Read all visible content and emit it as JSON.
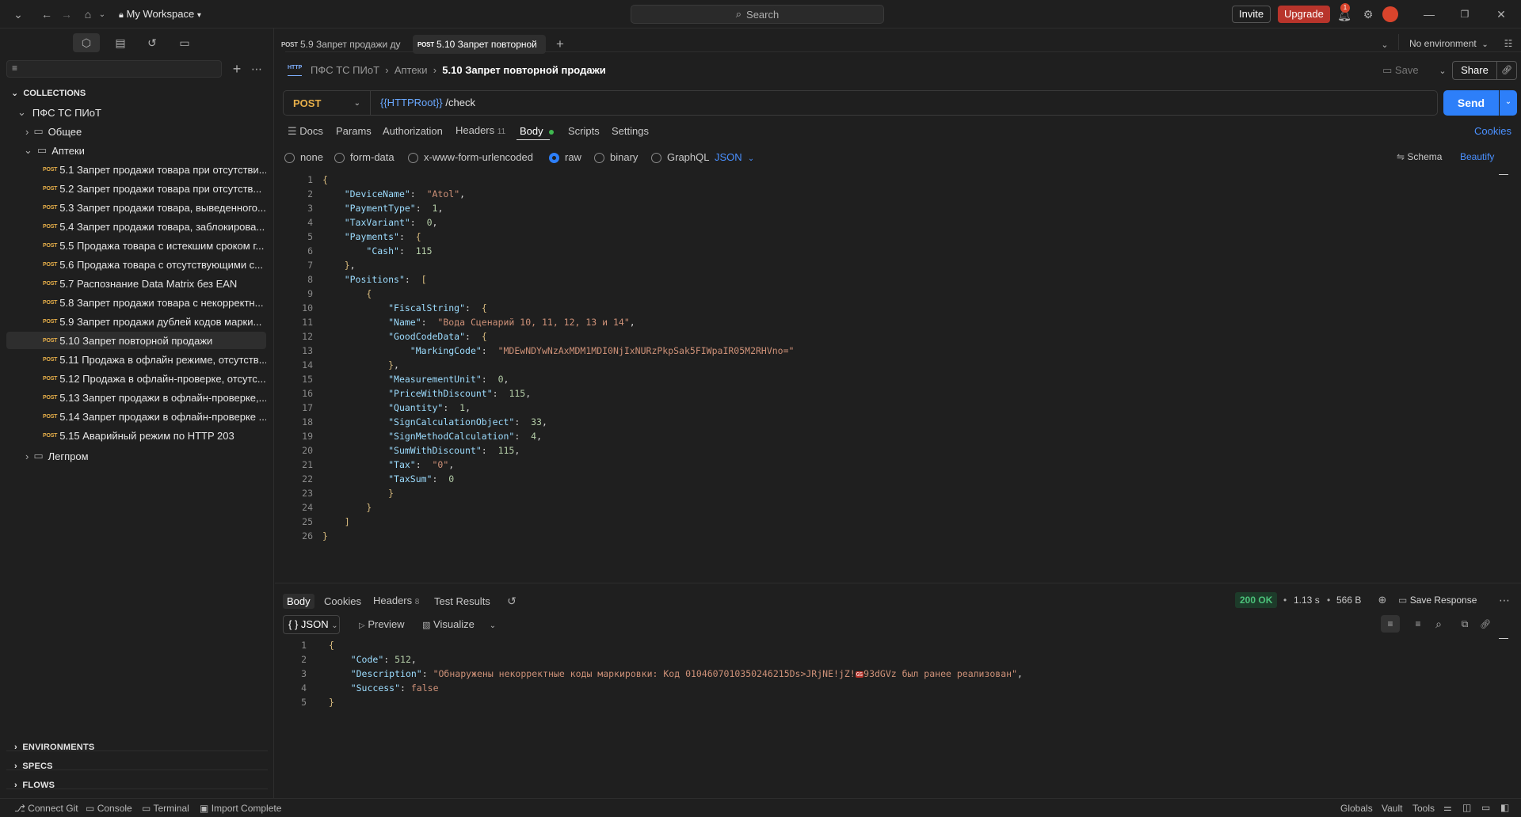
{
  "topbar": {
    "workspace": "My Workspace",
    "search_placeholder": "Search",
    "invite": "Invite",
    "upgrade": "Upgrade",
    "notif_count": "1"
  },
  "tabs": [
    {
      "method": "POST",
      "title": "5.9 Запрет продажи ду"
    },
    {
      "method": "POST",
      "title": "5.10 Запрет повторной"
    }
  ],
  "environment": "No environment",
  "breadcrumb": {
    "collection": "ПФС ТС ПИоТ",
    "folder": "Аптеки",
    "current": "5.10 Запрет повторной продажи"
  },
  "request": {
    "method": "POST",
    "url_var": "{{HTTPRoot}}",
    "url_path": " /check",
    "save": "Save",
    "share": "Share",
    "send": "Send"
  },
  "req_tabs": {
    "docs": "Docs",
    "params": "Params",
    "authorization": "Authorization",
    "headers": "Headers",
    "headers_count": "11",
    "body": "Body",
    "scripts": "Scripts",
    "settings": "Settings",
    "cookies": "Cookies"
  },
  "body_types": {
    "none": "none",
    "form_data": "form-data",
    "urlencoded": "x-www-form-urlencoded",
    "raw": "raw",
    "binary": "binary",
    "graphql": "GraphQL",
    "format": "JSON",
    "schema": "Schema",
    "beautify": "Beautify"
  },
  "request_body": [
    [
      {
        "t": "{",
        "c": "b"
      }
    ],
    [
      {
        "t": "    "
      },
      {
        "t": "\"DeviceName\"",
        "c": "k"
      },
      {
        "t": ":  "
      },
      {
        "t": "\"Atol\"",
        "c": "s"
      },
      {
        "t": ","
      }
    ],
    [
      {
        "t": "    "
      },
      {
        "t": "\"PaymentType\"",
        "c": "k"
      },
      {
        "t": ":  "
      },
      {
        "t": "1",
        "c": "n"
      },
      {
        "t": ","
      }
    ],
    [
      {
        "t": "    "
      },
      {
        "t": "\"TaxVariant\"",
        "c": "k"
      },
      {
        "t": ":  "
      },
      {
        "t": "0",
        "c": "n"
      },
      {
        "t": ","
      }
    ],
    [
      {
        "t": "    "
      },
      {
        "t": "\"Payments\"",
        "c": "k"
      },
      {
        "t": ":  "
      },
      {
        "t": "{",
        "c": "b"
      }
    ],
    [
      {
        "t": "        "
      },
      {
        "t": "\"Cash\"",
        "c": "k"
      },
      {
        "t": ":  "
      },
      {
        "t": "115",
        "c": "n"
      }
    ],
    [
      {
        "t": "    "
      },
      {
        "t": "}",
        "c": "b"
      },
      {
        "t": ","
      }
    ],
    [
      {
        "t": "    "
      },
      {
        "t": "\"Positions\"",
        "c": "k"
      },
      {
        "t": ":  "
      },
      {
        "t": "[",
        "c": "b"
      }
    ],
    [
      {
        "t": "        "
      },
      {
        "t": "{",
        "c": "b"
      }
    ],
    [
      {
        "t": "            "
      },
      {
        "t": "\"FiscalString\"",
        "c": "k"
      },
      {
        "t": ":  "
      },
      {
        "t": "{",
        "c": "b"
      }
    ],
    [
      {
        "t": "            "
      },
      {
        "t": "\"Name\"",
        "c": "k"
      },
      {
        "t": ":  "
      },
      {
        "t": "\"Вода Сценарий 10, 11, 12, 13 и 14\"",
        "c": "s"
      },
      {
        "t": ","
      }
    ],
    [
      {
        "t": "            "
      },
      {
        "t": "\"GoodCodeData\"",
        "c": "k"
      },
      {
        "t": ":  "
      },
      {
        "t": "{",
        "c": "b"
      }
    ],
    [
      {
        "t": "                "
      },
      {
        "t": "\"MarkingCode\"",
        "c": "k"
      },
      {
        "t": ":  "
      },
      {
        "t": "\"MDEwNDYwNzAxMDM1MDI0NjIxNURzPkpSak5FIWpaIR05M2RHVno=\"",
        "c": "s"
      }
    ],
    [
      {
        "t": "            "
      },
      {
        "t": "}",
        "c": "b"
      },
      {
        "t": ","
      }
    ],
    [
      {
        "t": "            "
      },
      {
        "t": "\"MeasurementUnit\"",
        "c": "k"
      },
      {
        "t": ":  "
      },
      {
        "t": "0",
        "c": "n"
      },
      {
        "t": ","
      }
    ],
    [
      {
        "t": "            "
      },
      {
        "t": "\"PriceWithDiscount\"",
        "c": "k"
      },
      {
        "t": ":  "
      },
      {
        "t": "115",
        "c": "n"
      },
      {
        "t": ","
      }
    ],
    [
      {
        "t": "            "
      },
      {
        "t": "\"Quantity\"",
        "c": "k"
      },
      {
        "t": ":  "
      },
      {
        "t": "1",
        "c": "n"
      },
      {
        "t": ","
      }
    ],
    [
      {
        "t": "            "
      },
      {
        "t": "\"SignCalculationObject\"",
        "c": "k"
      },
      {
        "t": ":  "
      },
      {
        "t": "33",
        "c": "n"
      },
      {
        "t": ","
      }
    ],
    [
      {
        "t": "            "
      },
      {
        "t": "\"SignMethodCalculation\"",
        "c": "k"
      },
      {
        "t": ":  "
      },
      {
        "t": "4",
        "c": "n"
      },
      {
        "t": ","
      }
    ],
    [
      {
        "t": "            "
      },
      {
        "t": "\"SumWithDiscount\"",
        "c": "k"
      },
      {
        "t": ":  "
      },
      {
        "t": "115",
        "c": "n"
      },
      {
        "t": ","
      }
    ],
    [
      {
        "t": "            "
      },
      {
        "t": "\"Tax\"",
        "c": "k"
      },
      {
        "t": ":  "
      },
      {
        "t": "\"0\"",
        "c": "s"
      },
      {
        "t": ","
      }
    ],
    [
      {
        "t": "            "
      },
      {
        "t": "\"TaxSum\"",
        "c": "k"
      },
      {
        "t": ":  "
      },
      {
        "t": "0",
        "c": "n"
      }
    ],
    [
      {
        "t": "            "
      },
      {
        "t": "}",
        "c": "b"
      }
    ],
    [
      {
        "t": "        "
      },
      {
        "t": "}",
        "c": "b"
      }
    ],
    [
      {
        "t": "    "
      },
      {
        "t": "]",
        "c": "b"
      }
    ],
    [
      {
        "t": "}",
        "c": "b"
      }
    ]
  ],
  "resp_tabs": {
    "body": "Body",
    "cookies": "Cookies",
    "headers": "Headers",
    "headers_count": "8",
    "test_results": "Test Results"
  },
  "resp_status": {
    "code": "200 OK",
    "time": "1.13 s",
    "size": "566 B",
    "save": "Save Response"
  },
  "resp_format": {
    "json": "{ } JSON",
    "preview": "Preview",
    "visualize": "Visualize"
  },
  "response_body": [
    [
      {
        "t": "{",
        "c": "b"
      }
    ],
    [
      {
        "t": "    "
      },
      {
        "t": "\"Code\"",
        "c": "k"
      },
      {
        "t": ": "
      },
      {
        "t": "512",
        "c": "n"
      },
      {
        "t": ","
      }
    ],
    [
      {
        "t": "    "
      },
      {
        "t": "\"Description\"",
        "c": "k"
      },
      {
        "t": ": "
      },
      {
        "t": "\"Обнаружены некорректные коды маркировки: Код 0104607010350246215Ds>JRjNE!jZ!",
        "c": "s"
      },
      {
        "t": "GS",
        "c": "gs"
      },
      {
        "t": "93dGVz был ранее реализован\"",
        "c": "s"
      },
      {
        "t": ","
      }
    ],
    [
      {
        "t": "    "
      },
      {
        "t": "\"Success\"",
        "c": "k"
      },
      {
        "t": ": "
      },
      {
        "t": "false",
        "c": "s"
      }
    ],
    [
      {
        "t": "}",
        "c": "b"
      }
    ]
  ],
  "sidebar": {
    "collections_label": "COLLECTIONS",
    "root": "ПФС ТС ПИоТ",
    "folders": {
      "general": "Общее",
      "pharmacy": "Аптеки",
      "legprom": "Легпром"
    },
    "method": "POST",
    "requests": [
      "5.1 Запрет продажи товара при отсутстви...",
      "5.2 Запрет продажи товара при отсутств...",
      "5.3 Запрет продажи товара, выведенного...",
      "5.4 Запрет продажи товара, заблокирова...",
      "5.5 Продажа товара с истекшим сроком г...",
      "5.6 Продажа товара с отсутствующими с...",
      "5.7 Распознание Data Matrix без EAN",
      "5.8 Запрет продажи товара с некорректн...",
      "5.9 Запрет продажи дублей кодов марки...",
      "5.10 Запрет повторной продажи",
      "5.11 Продажа в офлайн режиме, отсутств...",
      "5.12 Продажа в офлайн-проверке, отсутс...",
      "5.13 Запрет продажи в офлайн-проверке,...",
      "5.14 Запрет продажи в офлайн-проверке ...",
      "5.15 Аварийный режим по HTTP 203"
    ],
    "environments": "ENVIRONMENTS",
    "specs": "SPECS",
    "flows": "FLOWS"
  },
  "status": {
    "git": "Connect Git",
    "console": "Console",
    "terminal": "Terminal",
    "import": "Import Complete",
    "globals": "Globals",
    "vault": "Vault",
    "tools": "Tools"
  },
  "colors": {
    "accent": "#2d7ff9",
    "upgrade": "#b8342b",
    "post": "#e8b04a",
    "ok": "#2e7d4f"
  }
}
